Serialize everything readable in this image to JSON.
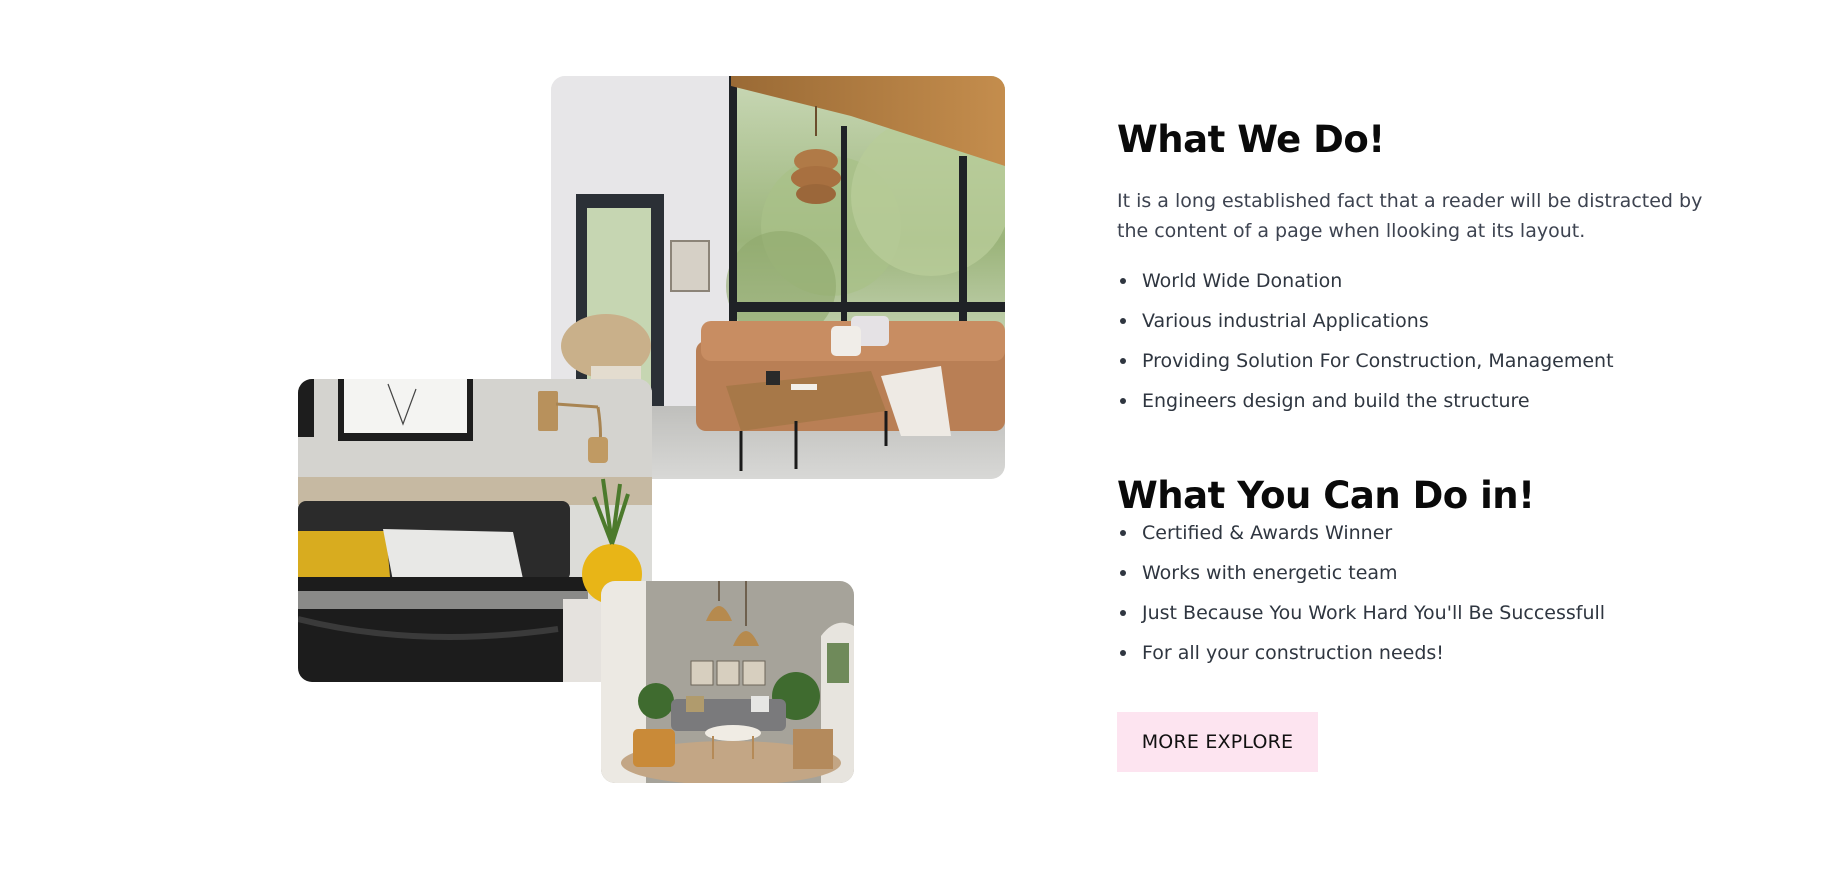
{
  "images": {
    "living_room": "living-room-photo",
    "bedroom": "bedroom-photo",
    "lounge": "lounge-photo"
  },
  "what_we_do": {
    "title": "What We Do!",
    "description": "It is a long established fact that a reader will be distracted by the content of a page when llooking at its layout.",
    "items": [
      "World Wide Donation",
      "Various industrial Applications",
      "Providing Solution For Construction, Management",
      "Engineers design and build the structure"
    ]
  },
  "what_you_can_do": {
    "title": "What You Can Do in!",
    "items": [
      "Certified & Awards Winner",
      "Works with energetic team",
      "Just Because You Work Hard You'll Be Successfull",
      "For all your construction needs!"
    ]
  },
  "cta": {
    "label": "MORE EXPLORE"
  },
  "colors": {
    "button_bg": "#fde4f0",
    "heading": "#0a0a0a",
    "body_text": "#2f3640"
  }
}
